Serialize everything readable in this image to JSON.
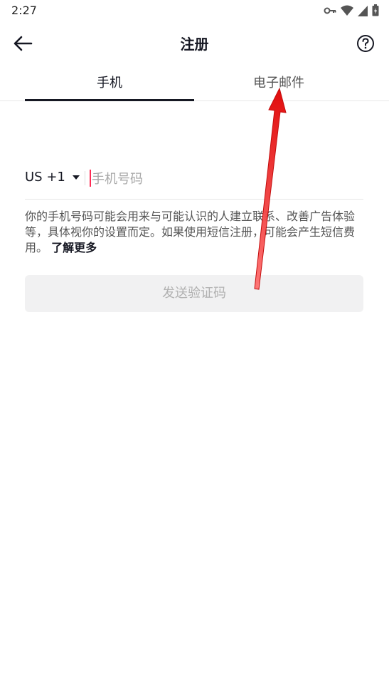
{
  "status_bar": {
    "time": "2:27",
    "icons": [
      "key-icon",
      "wifi-icon",
      "signal-icon",
      "battery-icon"
    ]
  },
  "header": {
    "title": "注册",
    "back_icon": "arrow-left-icon",
    "help_icon": "question-circle-icon"
  },
  "tabs": [
    {
      "label": "手机",
      "active": true
    },
    {
      "label": "电子邮件",
      "active": false
    }
  ],
  "phone_form": {
    "country_code": "US +1",
    "placeholder": "手机号码",
    "value": ""
  },
  "disclaimer": {
    "text": "你的手机号码可能会用来与可能认识的人建立联系、改善广告体验等，具体视你的设置而定。如果使用短信注册，可能会产生短信费用。",
    "link": "了解更多"
  },
  "send_button": {
    "label": "发送验证码",
    "enabled": false
  },
  "colors": {
    "accent": "#fe2c55",
    "annotation_arrow": "#ff0000",
    "button_disabled_bg": "#f1f1f2"
  }
}
